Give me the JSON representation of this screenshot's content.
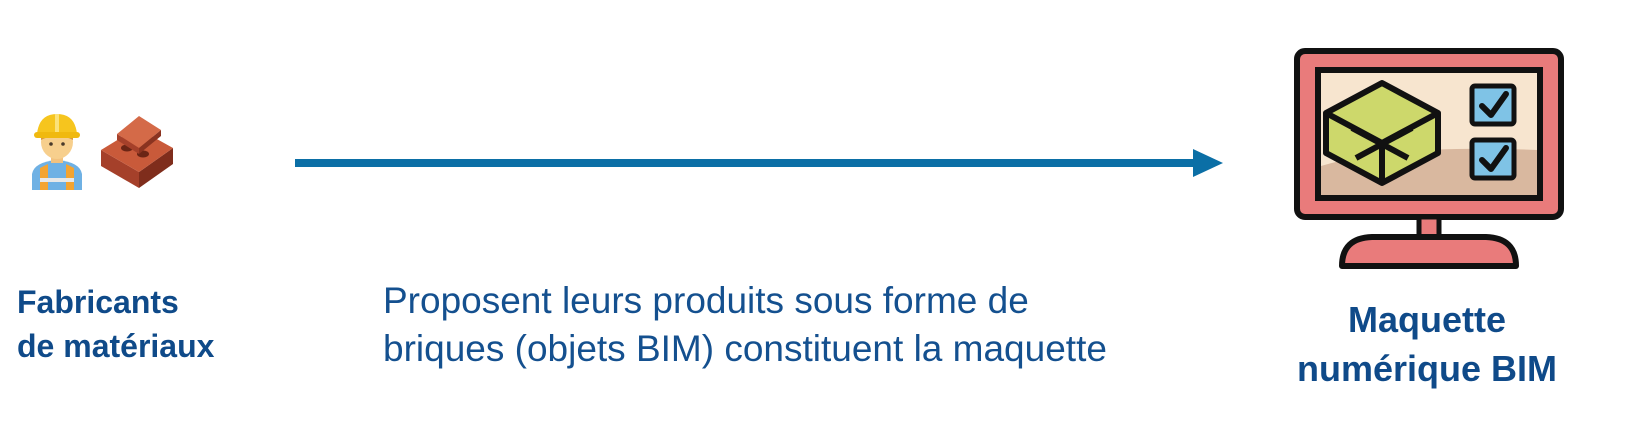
{
  "source": {
    "line1": "Fabricants",
    "line2": "de matériaux"
  },
  "flow": {
    "line1": "Proposent leurs produits sous forme de",
    "line2": "briques (objets BIM) constituent la maquette"
  },
  "target": {
    "line1": "Maquette",
    "line2": "numérique BIM"
  },
  "icons": {
    "worker": "construction-worker-icon",
    "brick": "brick-icon",
    "monitor": "bim-monitor-icon",
    "arrow": "arrow-right-icon"
  },
  "colors": {
    "text": "#0f4a89",
    "arrow": "#0b6fa6",
    "monitor_frame": "#e97b7b",
    "cube": "#cdd86b",
    "check_box": "#7fc3e6"
  }
}
